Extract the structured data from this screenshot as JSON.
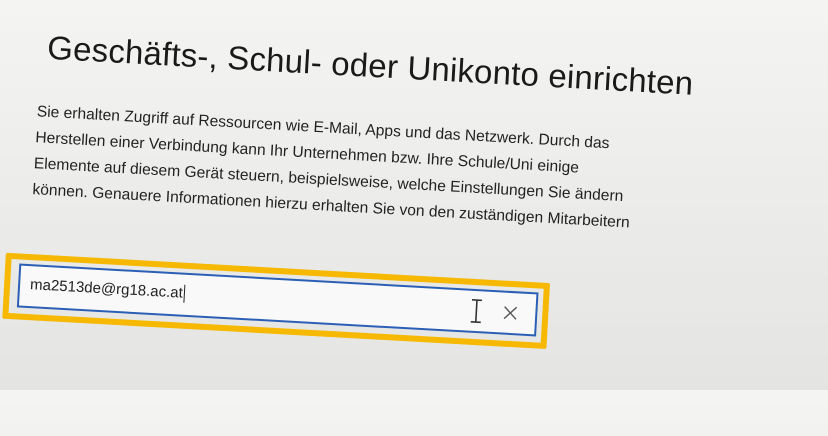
{
  "dialog": {
    "title": "Geschäfts-, Schul- oder Unikonto einrichten",
    "description_lines": [
      "Sie erhalten Zugriff auf Ressourcen wie E-Mail, Apps und das Netzwerk. Durch das",
      "Herstellen einer Verbindung kann Ihr Unternehmen bzw. Ihre Schule/Uni einige",
      "Elemente auf diesem Gerät steuern, beispielsweise, welche Einstellungen Sie ändern",
      "können. Genauere Informationen hierzu erhalten Sie von den zuständigen Mitarbeitern"
    ]
  },
  "email_input": {
    "value": "ma2513de@rg18.ac.at"
  },
  "icons": {
    "text_cursor": "i-beam-cursor-icon",
    "clear": "clear-x-icon"
  },
  "colors": {
    "highlight": "#f6b800",
    "input_border": "#2b5fb5"
  }
}
